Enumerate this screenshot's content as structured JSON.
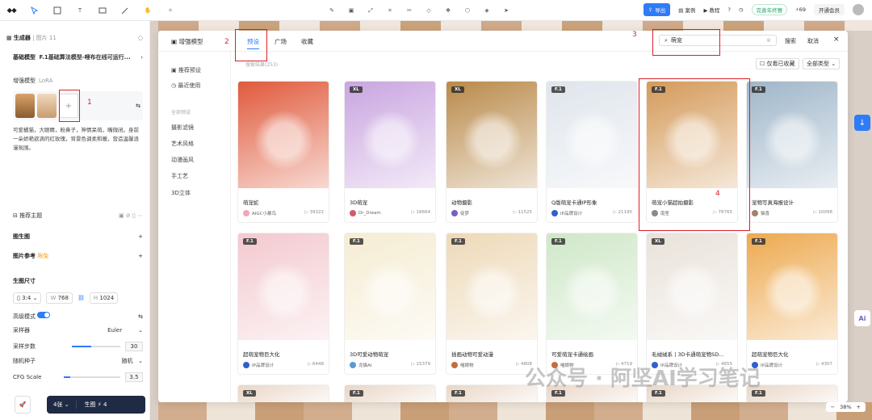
{
  "toolbar": {
    "export_label": "导出",
    "cases_label": "案例",
    "tutorial_label": "教程",
    "promo_label": "完善年终赛",
    "points": "69",
    "member_label": "开通会员"
  },
  "left_panel": {
    "title": "生成器",
    "title_suffix": "| 图片 11",
    "base_model_label": "基础模型",
    "base_model_value": "F.1基础算法模型-哩布在线可运行...",
    "enhance_label": "增强模型",
    "enhance_sub": "LoRA",
    "prompt_text": "可爱橘猫，大眼睛，粉鼻子，神情呆萌，嘴微闭。身前一朵娇艳欲滴的红玫瑰，背景色调柔和暖，营造温馨浪漫氛围。",
    "recommend_label": "推荐主题",
    "img2img_label": "图生图",
    "img_ref_label": "图片参考",
    "img_ref_tag": "限免",
    "size_label": "生图尺寸",
    "ratio": "3:4",
    "width_label": "W",
    "width": "768",
    "height_label": "H",
    "height": "1024",
    "advanced_label": "高级模式",
    "sampler_label": "采样器",
    "sampler_value": "Euler",
    "steps_label": "采样步数",
    "steps_value": "30",
    "steps_fill": 0.4,
    "seed_label": "随机种子",
    "seed_value": "随机",
    "cfg_label": "CFG Scale",
    "cfg_value": "3.5",
    "cfg_fill": 0.12,
    "count_label": "4张",
    "generate_label": "生图",
    "generate_cost": "4"
  },
  "modal": {
    "title": "增强模型",
    "tabs": [
      "预设",
      "广场",
      "收藏"
    ],
    "active_tab": "预设",
    "search_value": "萌宠",
    "search_button": "搜索",
    "cancel_button": "取消",
    "result_count": "搜索结果(253)",
    "only_favorites": "仅看已收藏",
    "all_types": "全部类型",
    "side": {
      "recommended": "推荐预设",
      "recent": "最近使用",
      "group_label": "全部预设",
      "categories": [
        "摄影滤镜",
        "艺术风格",
        "动漫画风",
        "手工艺",
        "3D立体"
      ]
    },
    "cards": [
      {
        "name": "萌宠蛇",
        "badge": "",
        "author": "AIGC小暴鸟",
        "uses": "39322",
        "color": "#e05a3c",
        "avatar": "#f3a6b5"
      },
      {
        "name": "3D萌宠",
        "badge": "XL",
        "author": "Dr_Dream",
        "uses": "18664",
        "color": "#c9a5e0",
        "avatar": "#d35b6a"
      },
      {
        "name": "动物摄影",
        "badge": "XL",
        "author": "徒梦",
        "uses": "11525",
        "color": "#b98a4a",
        "avatar": "#7b5cc4"
      },
      {
        "name": "Q版萌宠卡通IP形象",
        "badge": "F.1",
        "author": "IP品牌设计",
        "uses": "21195",
        "color": "#dfe5ec",
        "avatar": "#2f5fd0"
      },
      {
        "name": "萌宠小猫超拍摄影",
        "badge": "F.1",
        "author": "南笙",
        "uses": "78765",
        "color": "#d49a59",
        "avatar": "#8a8a8a"
      },
      {
        "name": "宠物写真海报设计",
        "badge": "F.1",
        "author": "猫喜",
        "uses": "10098",
        "color": "#9fb6c9",
        "avatar": "#a3836a"
      },
      {
        "name": "超萌宠物巨大化",
        "badge": "F.1",
        "author": "IP品牌设计",
        "uses": "6448",
        "color": "#f3c9cf",
        "avatar": "#2f5fd0"
      },
      {
        "name": "3D可爱动物萌宠",
        "badge": "F.1",
        "author": "龙猫AI",
        "uses": "15379",
        "color": "#f5ecd2",
        "avatar": "#5b9bd5"
      },
      {
        "name": "插画动物可爱动漫",
        "badge": "F.1",
        "author": "喵娘物",
        "uses": "4808",
        "color": "#eed9b8",
        "avatar": "#c86b3c"
      },
      {
        "name": "可爱萌宠卡通绘画",
        "badge": "F.1",
        "author": "喵娘物",
        "uses": "4719",
        "color": "#cfe7c8",
        "avatar": "#c86b3c"
      },
      {
        "name": "毛绒绒系丨3D卡通萌宠物SD...",
        "badge": "XL",
        "author": "IP品牌设计",
        "uses": "4655",
        "color": "#e9e2da",
        "avatar": "#2f5fd0"
      },
      {
        "name": "超萌宠物巨大化",
        "badge": "F.1",
        "author": "IP品牌设计",
        "uses": "4307",
        "color": "#eda94f",
        "avatar": "#2f5fd0"
      }
    ],
    "bottom_badges": [
      "XL",
      "F.1",
      "F.1",
      "F.1",
      "F.1",
      "F.1"
    ]
  },
  "annotations": [
    "1",
    "2",
    "3",
    "4"
  ],
  "watermark": "公众号 · 阿坚AI学习笔记",
  "zoom": "38%",
  "colors": {
    "accent": "#2f7cf6",
    "annotation": "#e11d2a"
  }
}
